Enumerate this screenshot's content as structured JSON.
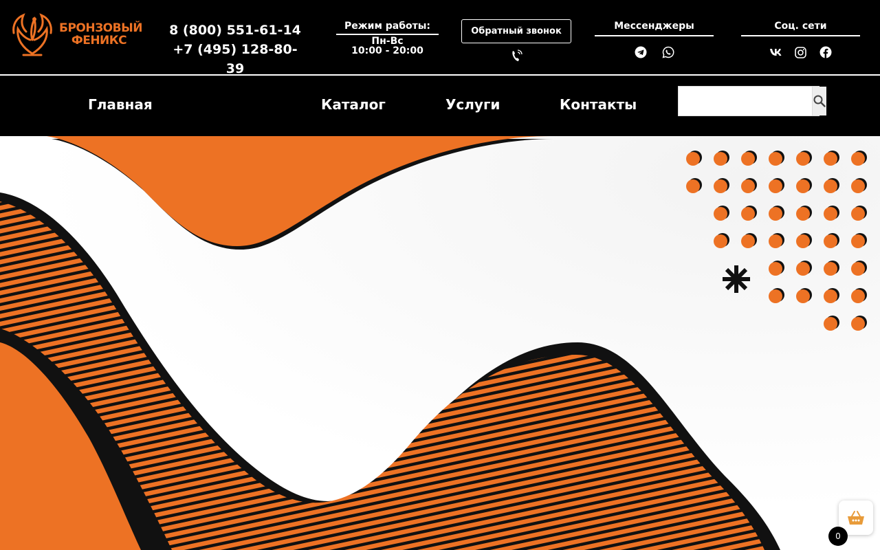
{
  "brand": {
    "name_line1": "БРОНЗОВЫЙ",
    "name_line2": "ФЕНИКС",
    "logo_icon": "phoenix-icon",
    "accent_color": "#ED7224"
  },
  "header": {
    "phones": [
      "8 (800) 551-61-14",
      "+7 (495) 128-80-39"
    ],
    "hours": {
      "title": "Режим работы:",
      "days": "Пн-Вс",
      "time": "10:00 - 20:00"
    },
    "callback_label": "Обратный звонок",
    "callback_icon": "phone-ringing-icon",
    "messengers": {
      "title": "Мессенджеры",
      "icons": [
        "telegram-icon",
        "whatsapp-icon"
      ]
    },
    "socials": {
      "title": "Соц. сети",
      "icons": [
        "vk-icon",
        "instagram-icon",
        "facebook-icon"
      ]
    }
  },
  "nav": {
    "items": [
      {
        "label": "Главная"
      },
      {
        "label": "Каталог"
      },
      {
        "label": "Услуги"
      },
      {
        "label": "Контакты"
      }
    ],
    "search": {
      "placeholder": "",
      "button_icon": "search-icon"
    }
  },
  "cart": {
    "icon": "basket-icon",
    "count": "0"
  }
}
